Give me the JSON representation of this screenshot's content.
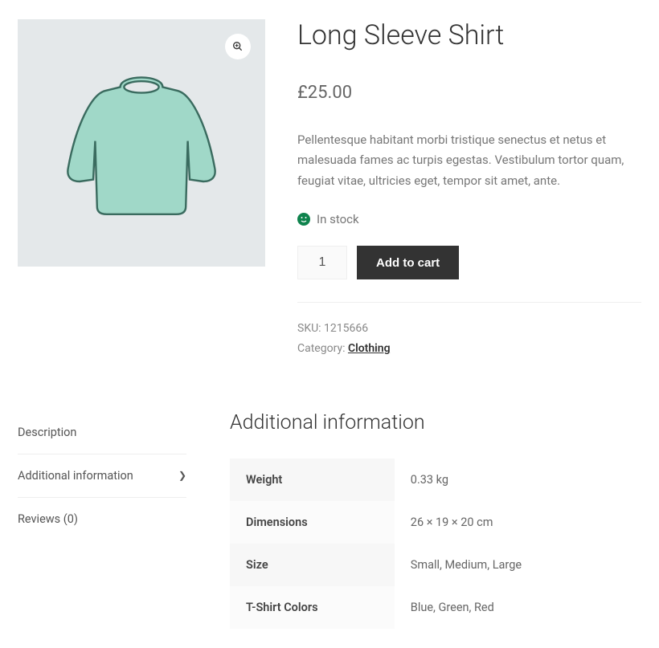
{
  "product": {
    "title": "Long Sleeve Shirt",
    "price": "£25.00",
    "description": "Pellentesque habitant morbi tristique senectus et netus et malesuada fames ac turpis egestas. Vestibulum tortor quam, feugiat vitae, ultricies eget, tempor sit amet, ante.",
    "stock_status": "In stock",
    "quantity": "1",
    "add_to_cart_label": "Add to cart",
    "sku_label": "SKU: ",
    "sku": "1215666",
    "category_label": "Category: ",
    "category": "Clothing"
  },
  "tabs": {
    "description": "Description",
    "additional_info": "Additional information",
    "reviews": "Reviews (0)"
  },
  "panel": {
    "heading": "Additional information",
    "rows": [
      {
        "label": "Weight",
        "value": "0.33 kg"
      },
      {
        "label": "Dimensions",
        "value": "26 × 19 × 20 cm"
      },
      {
        "label": "Size",
        "value": "Small, Medium, Large"
      },
      {
        "label": "T-Shirt Colors",
        "value": "Blue, Green, Red"
      }
    ]
  }
}
